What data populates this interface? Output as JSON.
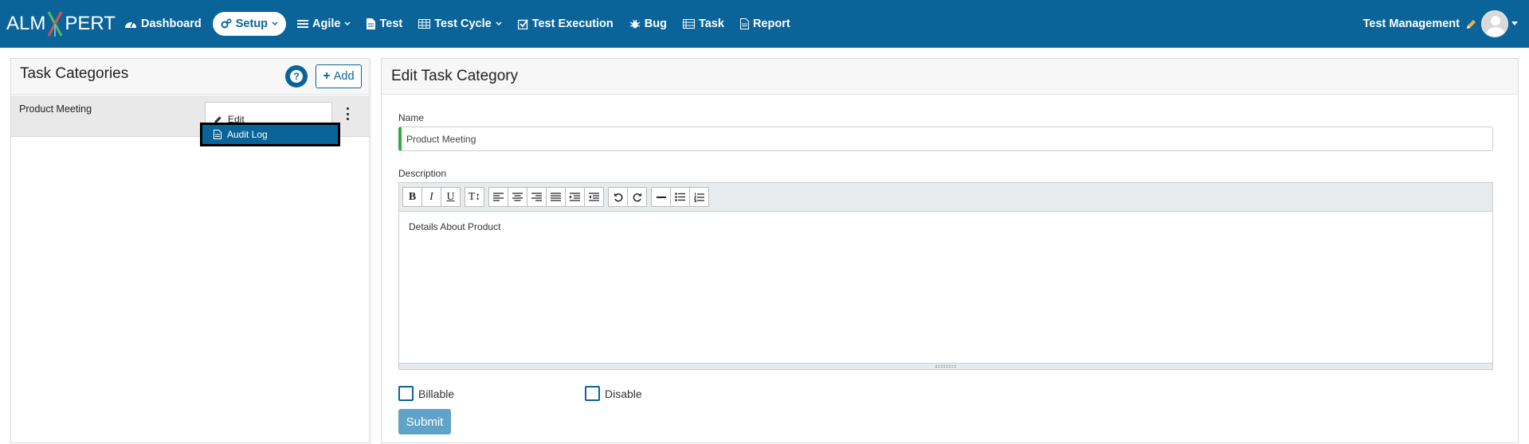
{
  "app": {
    "brand_left": "ALM",
    "brand_right": "PERT",
    "brand_colors": {
      "x_green": "#5cb85c",
      "x_red": "#d9534f",
      "x_blue": "#5bc0de"
    }
  },
  "nav": {
    "items": [
      {
        "label": "Dashboard",
        "icon": "dashboard-icon",
        "has_caret": false,
        "active": false
      },
      {
        "label": "Setup",
        "icon": "cogs-icon",
        "has_caret": true,
        "active": true
      },
      {
        "label": "Agile",
        "icon": "list-icon",
        "has_caret": true,
        "active": false
      },
      {
        "label": "Test",
        "icon": "file-icon",
        "has_caret": false,
        "active": false
      },
      {
        "label": "Test Cycle",
        "icon": "table-icon",
        "has_caret": true,
        "active": false
      },
      {
        "label": "Test Execution",
        "icon": "check-square-icon",
        "has_caret": false,
        "active": false
      },
      {
        "label": "Bug",
        "icon": "bug-icon",
        "has_caret": false,
        "active": false
      },
      {
        "label": "Task",
        "icon": "tasks-icon",
        "has_caret": false,
        "active": false
      },
      {
        "label": "Report",
        "icon": "file-text-icon",
        "has_caret": false,
        "active": false
      }
    ],
    "user_label": "Test Management"
  },
  "left_panel": {
    "title": "Task Categories",
    "help_label": "?",
    "add_label": "Add",
    "items": [
      {
        "label": "Product Meeting"
      }
    ],
    "menu": {
      "edit_label": "Edit",
      "audit_label": "Audit Log"
    }
  },
  "right_panel": {
    "title": "Edit Task Category",
    "name_label": "Name",
    "name_value": "Product Meeting",
    "description_label": "Description",
    "description_value": "Details About Product",
    "toolbar": {
      "bold": "B",
      "italic": "I",
      "underline": "U",
      "font_size": "T↕"
    },
    "billable_label": "Billable",
    "disable_label": "Disable",
    "submit_label": "Submit"
  },
  "colors": {
    "nav_bg": "#0a6499",
    "accent": "#0a6499",
    "name_valid_border": "#3aa64a",
    "submit_disabled": "#5fa3c9"
  }
}
